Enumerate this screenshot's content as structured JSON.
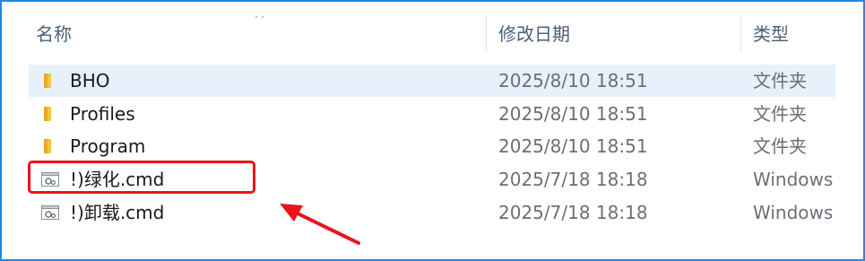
{
  "header": {
    "name_label": "名称",
    "date_label": "修改日期",
    "type_label": "类型"
  },
  "files": [
    {
      "name": "BHO",
      "date": "2025/8/10 18:51",
      "type": "文件夹",
      "icon": "folder-icon",
      "selected": true
    },
    {
      "name": "Profiles",
      "date": "2025/8/10 18:51",
      "type": "文件夹",
      "icon": "folder-icon",
      "selected": false
    },
    {
      "name": "Program",
      "date": "2025/8/10 18:51",
      "type": "文件夹",
      "icon": "folder-icon",
      "selected": false
    },
    {
      "name": "!)绿化.cmd",
      "date": "2025/7/18 18:18",
      "type": "Windows",
      "icon": "cmd-script-icon",
      "selected": false
    },
    {
      "name": "!)卸载.cmd",
      "date": "2025/7/18 18:18",
      "type": "Windows",
      "icon": "cmd-script-icon",
      "selected": false
    }
  ],
  "annotation": {
    "highlight_color": "#e8141a",
    "arrow_color": "#e8141a"
  },
  "colors": {
    "frame_border": "#1f88e5",
    "selected_row": "#e7f1fb",
    "folder": "#f6c343"
  }
}
